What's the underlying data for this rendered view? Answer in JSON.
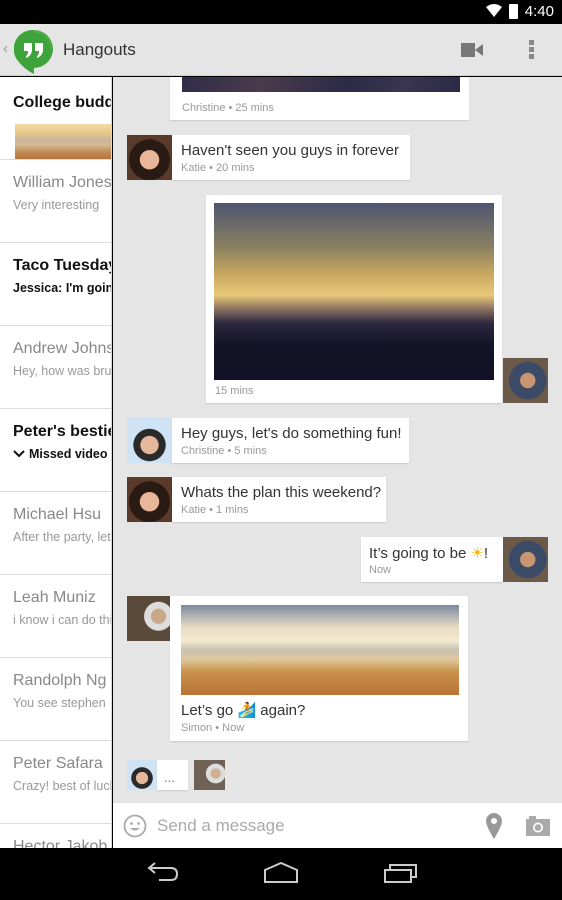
{
  "status_bar": {
    "time": "4:40",
    "icons": [
      "wifi-icon",
      "battery-icon"
    ]
  },
  "action_bar": {
    "title": "Hangouts",
    "icons": [
      "up-caret-icon",
      "hangouts-logo-icon",
      "video-call-icon",
      "overflow-menu-icon"
    ]
  },
  "conversations": [
    {
      "name": "College buddies",
      "snippet": "",
      "unread": true,
      "has_thumbnail": true
    },
    {
      "name": "William Jones",
      "snippet": "Very interesting",
      "unread": false
    },
    {
      "name": "Taco Tuesday",
      "snippet": "Jessica: I'm going",
      "unread": true
    },
    {
      "name": "Andrew Johnson",
      "snippet": "Hey, how was brunch",
      "unread": false
    },
    {
      "name": "Peter's besties",
      "snippet": "Missed video call",
      "unread": true,
      "icon": "missed-call-icon"
    },
    {
      "name": "Michael Hsu",
      "snippet": "After the party, let's",
      "unread": false
    },
    {
      "name": "Leah Muniz",
      "snippet": "i know i can do this",
      "unread": false
    },
    {
      "name": "Randolph Ng",
      "snippet": "You see stephen",
      "unread": false
    },
    {
      "name": "Peter Safara",
      "snippet": "Crazy! best of luck",
      "unread": false
    },
    {
      "name": "Hector Jakob M",
      "snippet": "",
      "unread": false
    }
  ],
  "messages": [
    {
      "type": "photo",
      "sender": "Christine",
      "meta": "Christine • 25 mins",
      "partial": true
    },
    {
      "type": "text",
      "sender": "Katie",
      "text": "Haven't seen you guys in forever",
      "meta": "Katie • 20 mins"
    },
    {
      "type": "photo",
      "sender": "me",
      "meta": "15 mins",
      "outgoing": true
    },
    {
      "type": "text",
      "sender": "Christine",
      "text": "Hey guys, let's do something fun!",
      "meta": "Christine • 5 mins"
    },
    {
      "type": "text",
      "sender": "Katie",
      "text": "Whats the plan this weekend?",
      "meta": "Katie • 1 mins"
    },
    {
      "type": "text",
      "sender": "me",
      "text": "It’s going to be ☀️!",
      "text_before": "It’s going to be ",
      "emoji": "sun-emoji",
      "text_after": "!",
      "meta": "Now",
      "outgoing": true
    },
    {
      "type": "photo_text",
      "sender": "Simon",
      "text_before": "Let’s go ",
      "emoji": "surfer-emoji",
      "text_after": " again?",
      "meta": "Simon • Now"
    },
    {
      "type": "typing",
      "sender": "Christine",
      "text": "..."
    }
  ],
  "compose": {
    "placeholder": "Send a message",
    "value": ""
  },
  "nav_bar": {
    "buttons": [
      "back-icon",
      "home-icon",
      "recents-icon"
    ]
  }
}
